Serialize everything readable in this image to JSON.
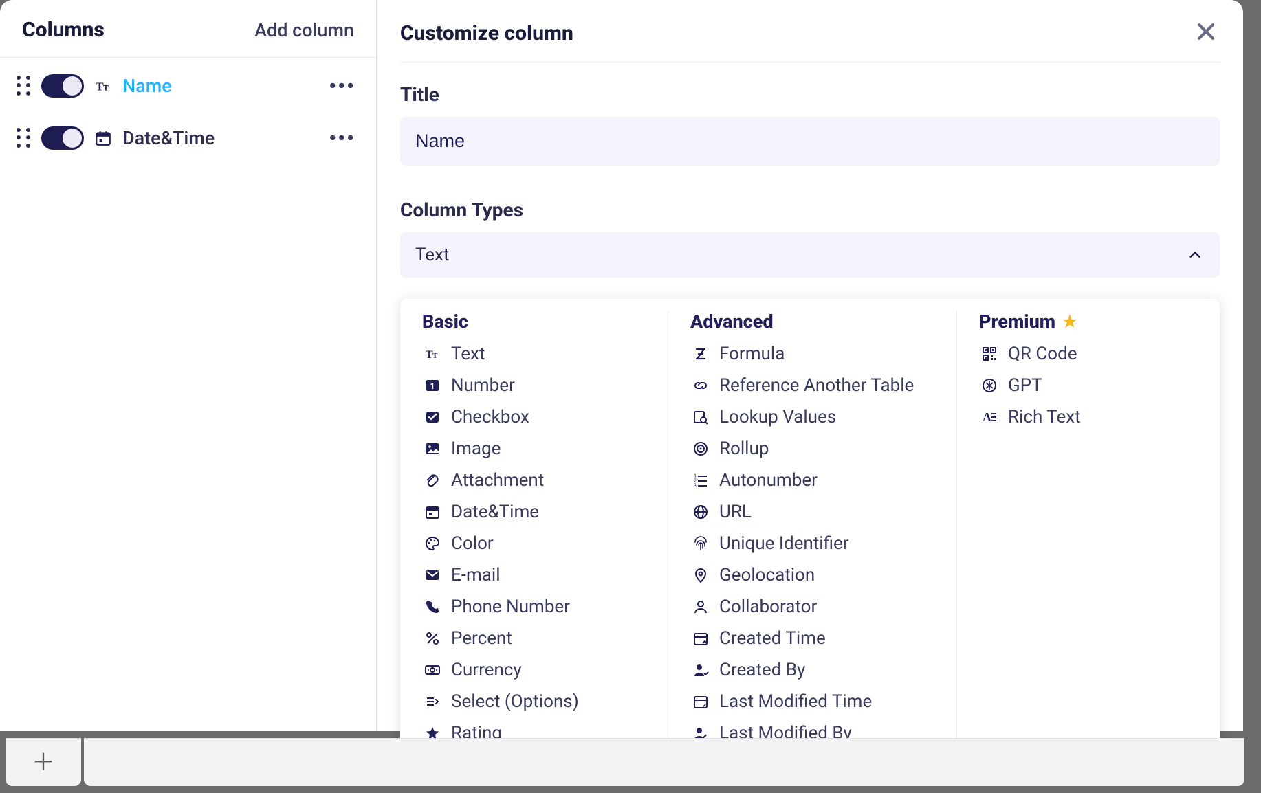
{
  "sidebar": {
    "title": "Columns",
    "add_label": "Add column",
    "columns": [
      {
        "label": "Name",
        "type_icon": "text-icon",
        "active": true
      },
      {
        "label": "Date&Time",
        "type_icon": "calendar-icon",
        "active": false
      }
    ]
  },
  "main": {
    "title": "Customize column",
    "title_section_label": "Title",
    "title_value": "Name",
    "types_section_label": "Column Types",
    "selected_type": "Text"
  },
  "dropdown": {
    "groups": [
      {
        "key": "basic",
        "label": "Basic",
        "items": [
          {
            "icon": "text-icon",
            "label": "Text"
          },
          {
            "icon": "number-icon",
            "label": "Number"
          },
          {
            "icon": "checkbox-icon",
            "label": "Checkbox"
          },
          {
            "icon": "image-icon",
            "label": "Image"
          },
          {
            "icon": "attachment-icon",
            "label": "Attachment"
          },
          {
            "icon": "calendar-icon",
            "label": "Date&Time"
          },
          {
            "icon": "color-icon",
            "label": "Color"
          },
          {
            "icon": "email-icon",
            "label": "E-mail"
          },
          {
            "icon": "phone-icon",
            "label": "Phone Number"
          },
          {
            "icon": "percent-icon",
            "label": "Percent"
          },
          {
            "icon": "currency-icon",
            "label": "Currency"
          },
          {
            "icon": "select-icon",
            "label": "Select (Options)"
          },
          {
            "icon": "rating-icon",
            "label": "Rating"
          }
        ]
      },
      {
        "key": "advanced",
        "label": "Advanced",
        "items": [
          {
            "icon": "formula-icon",
            "label": "Formula"
          },
          {
            "icon": "link-icon",
            "label": "Reference Another Table"
          },
          {
            "icon": "lookup-icon",
            "label": "Lookup Values"
          },
          {
            "icon": "rollup-icon",
            "label": "Rollup"
          },
          {
            "icon": "autonumber-icon",
            "label": "Autonumber"
          },
          {
            "icon": "url-icon",
            "label": "URL"
          },
          {
            "icon": "fingerprint-icon",
            "label": "Unique Identifier"
          },
          {
            "icon": "geolocation-icon",
            "label": "Geolocation"
          },
          {
            "icon": "collaborator-icon",
            "label": "Collaborator"
          },
          {
            "icon": "created-time-icon",
            "label": "Created Time"
          },
          {
            "icon": "created-by-icon",
            "label": "Created By"
          },
          {
            "icon": "modified-time-icon",
            "label": "Last Modified Time"
          },
          {
            "icon": "modified-by-icon",
            "label": "Last Modified By"
          }
        ]
      },
      {
        "key": "premium",
        "label": "Premium",
        "premium": true,
        "items": [
          {
            "icon": "qr-icon",
            "label": "QR Code"
          },
          {
            "icon": "gpt-icon",
            "label": "GPT"
          },
          {
            "icon": "rich-text-icon",
            "label": "Rich Text"
          }
        ]
      }
    ]
  },
  "colors": {
    "accent": "#1fb3ff",
    "ink": "#1f1f56",
    "panel_bg": "#f4f3fb",
    "star": "#f6b61e"
  }
}
